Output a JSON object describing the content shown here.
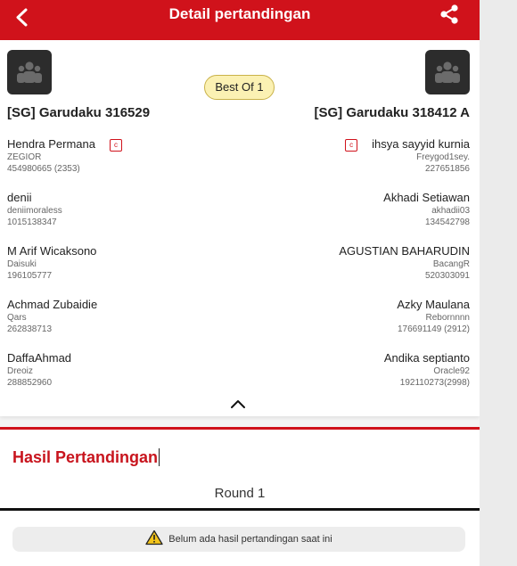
{
  "header": {
    "title": "Detail pertandingan",
    "back_icon": "arrow-left-icon",
    "share_icon": "share-icon",
    "color": "#d0121b"
  },
  "match": {
    "format": "Best Of 1",
    "team_a": {
      "name": "[SG] Garudaku 316529",
      "avatar_icon": "group-icon",
      "players": [
        {
          "name": "Hendra Permana",
          "ign": "ZEGIOR",
          "id": "454980665 (2353)",
          "captain": "c"
        },
        {
          "name": "denii",
          "ign": "deniimoraless",
          "id": "1015138347"
        },
        {
          "name": "M Arif Wicaksono",
          "ign": "Daisuki",
          "id": "196105777"
        },
        {
          "name": "Achmad Zubaidie",
          "ign": "Qars",
          "id": "262838713"
        },
        {
          "name": "DaffaAhmad",
          "ign": "Dreoiz",
          "id": "288852960"
        }
      ]
    },
    "team_b": {
      "name": "[SG] Garudaku 318412 A",
      "avatar_icon": "group-icon",
      "players": [
        {
          "name": "ihsya sayyid kurnia",
          "ign": "Freygod1sey.",
          "id": "227651856",
          "captain": "c"
        },
        {
          "name": "Akhadi Setiawan",
          "ign": "akhadii03",
          "id": "134542798"
        },
        {
          "name": "AGUSTIAN BAHARUDIN",
          "ign": "BacangR",
          "id": "520303091"
        },
        {
          "name": "Azky Maulana",
          "ign": "Rebornnnn",
          "id": "176691149 (2912)"
        },
        {
          "name": "Andika septianto",
          "ign": "Oracle92",
          "id": "192110273(2998)"
        }
      ]
    }
  },
  "results": {
    "title": "Hasil Pertandingan",
    "round_label": "Round 1",
    "empty_message": "Belum ada hasil pertandingan saat ini",
    "warning_icon": "warning-icon"
  }
}
